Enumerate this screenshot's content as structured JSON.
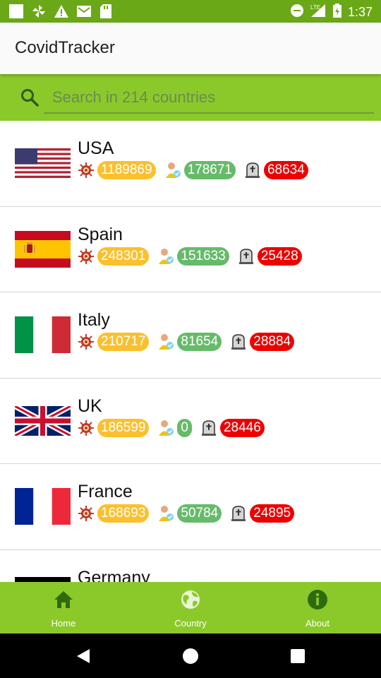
{
  "status_bar": {
    "time": "1:37",
    "network": "LTE"
  },
  "app": {
    "title": "CovidTracker"
  },
  "search": {
    "placeholder": "Search in 214 countries"
  },
  "countries": [
    {
      "name": "USA",
      "cases": "1189869",
      "recovered": "178671",
      "deaths": "68634",
      "flag": "us-flag"
    },
    {
      "name": "Spain",
      "cases": "248301",
      "recovered": "151633",
      "deaths": "25428",
      "flag": "spain-flag"
    },
    {
      "name": "Italy",
      "cases": "210717",
      "recovered": "81654",
      "deaths": "28884",
      "flag": "italy-flag"
    },
    {
      "name": "UK",
      "cases": "186599",
      "recovered": "0",
      "deaths": "28446",
      "flag": "uk-flag"
    },
    {
      "name": "France",
      "cases": "168693",
      "recovered": "50784",
      "deaths": "24895",
      "flag": "france-flag"
    },
    {
      "name": "Germany",
      "flag": "germany-flag"
    }
  ],
  "nav": [
    {
      "label": "Home",
      "icon": "home-icon"
    },
    {
      "label": "Country",
      "icon": "globe-icon"
    },
    {
      "label": "About",
      "icon": "info-icon"
    }
  ],
  "colors": {
    "primary": "#8bc92a",
    "status_bar": "#6aa817",
    "cases": "#fbc02d",
    "recovered": "#66bb6a",
    "deaths": "#ee0000",
    "nav_icon": "#2e6b0f"
  }
}
